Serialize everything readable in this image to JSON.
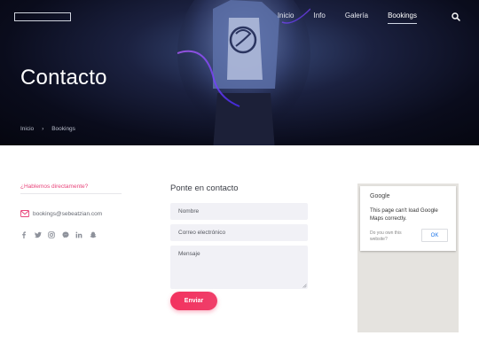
{
  "header": {
    "nav": [
      "Inicio",
      "Info",
      "Galería",
      "Bookings"
    ],
    "active_nav": "Bookings",
    "search_icon": "search-icon"
  },
  "hero": {
    "title": "Contacto",
    "breadcrumb": [
      "Inicio",
      "Bookings"
    ],
    "breadcrumb_separator": "›"
  },
  "contact": {
    "talk_link": "¿Hablemos directamente?",
    "email": "bookings@sebeatzian.com",
    "socials": [
      "facebook-icon",
      "twitter-icon",
      "instagram-icon",
      "messenger-icon",
      "linkedin-icon",
      "snapchat-icon"
    ]
  },
  "form": {
    "title": "Ponte en contacto",
    "name_placeholder": "Nombre",
    "email_placeholder": "Correo electrónico",
    "message_placeholder": "Mensaje",
    "submit_label": "Enviar"
  },
  "map": {
    "brand": "Google",
    "error_message": "This page can't load Google Maps correctly.",
    "own_site_prompt": "Do you own this website?",
    "ok_label": "OK"
  },
  "colors": {
    "accent": "#f2325f",
    "link_pink": "#e8457b",
    "field_bg": "#f1f1f6",
    "hero_dark": "#0a0c1c"
  }
}
